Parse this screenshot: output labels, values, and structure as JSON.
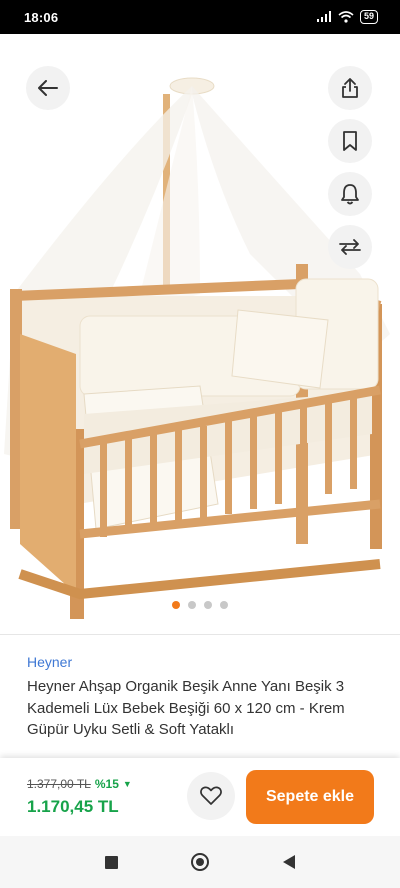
{
  "status_bar": {
    "time": "18:06",
    "battery": "59",
    "icons": [
      "signal-icon",
      "wifi-icon",
      "battery-icon"
    ]
  },
  "gallery": {
    "image": "wooden-baby-crib-with-canopy",
    "actions": [
      "back-arrow-icon",
      "share-icon",
      "bookmark-icon",
      "bell-icon",
      "compare-icon"
    ],
    "dots_total": 4,
    "dots_active": 0
  },
  "product": {
    "brand": "Heyner",
    "title": "Heyner Ahşap Organik Beşik Anne Yanı Beşik 3 Kademeli Lüx Bebek Beşiği 60 x 120 cm - Krem Güpür Uyku Setli & Soft Yataklı"
  },
  "pricing": {
    "old_price": "1.377,00 TL",
    "discount": "%15",
    "price": "1.170,45 TL"
  },
  "actions": {
    "add_to_cart": "Sepete ekle"
  },
  "colors": {
    "accent": "#f27a1a",
    "price_green": "#17a34a",
    "brand_blue": "#3f78d4"
  }
}
